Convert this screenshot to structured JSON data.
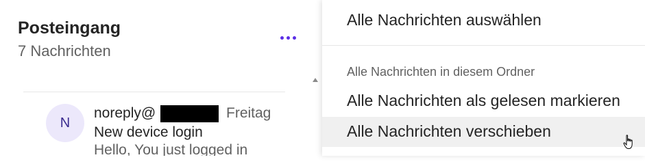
{
  "folder": {
    "title": "Posteingang",
    "count_text": "7 Nachrichten"
  },
  "message": {
    "avatar_initial": "N",
    "sender": "noreply@",
    "date": "Freitag",
    "subject": "New device login",
    "preview": "Hello, You just logged in"
  },
  "menu": {
    "select_all": "Alle Nachrichten auswählen",
    "section_header": "Alle Nachrichten in diesem Ordner",
    "mark_read": "Alle Nachrichten als gelesen markieren",
    "move_all": "Alle Nachrichten verschieben"
  },
  "colors": {
    "accent": "#5b2ee6",
    "avatar_bg": "#ece8fb",
    "hover_bg": "#f0f0f0"
  },
  "icons": {
    "more": "more-horizontal-icon",
    "scroll": "scroll-up-arrow-icon",
    "cursor": "hand-pointer-cursor-icon"
  }
}
